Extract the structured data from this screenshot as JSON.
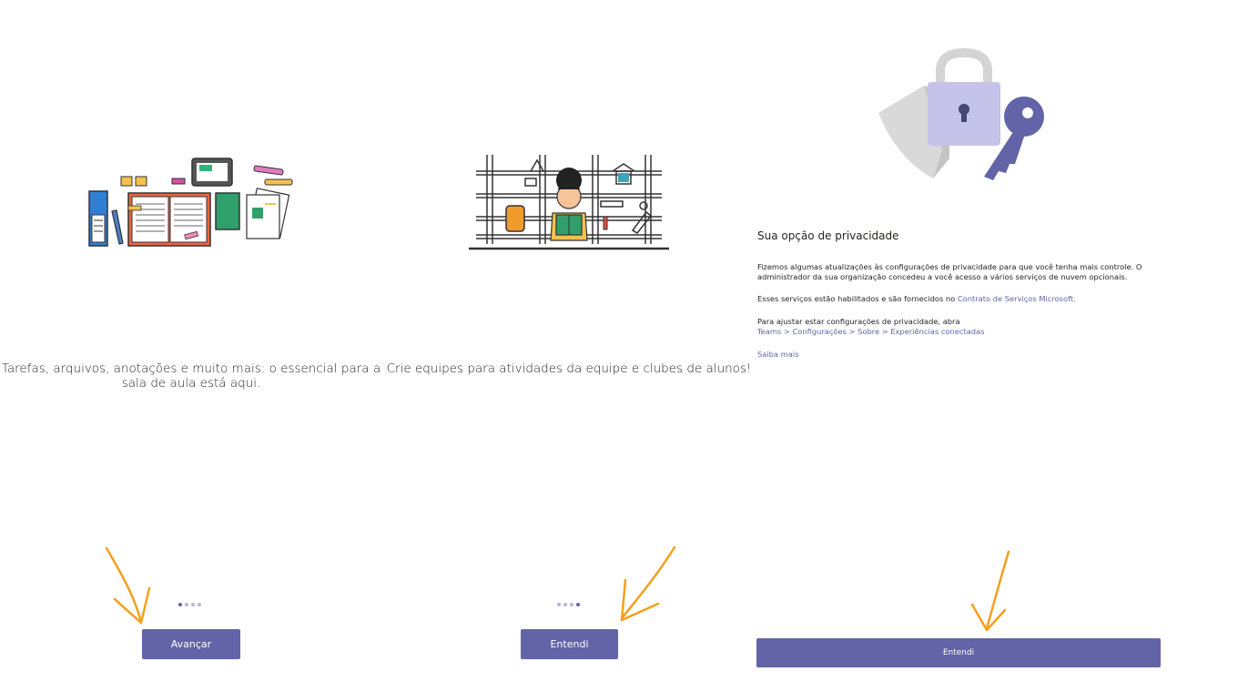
{
  "panels": [
    {
      "caption": "Tarefas, arquivos, anotações e muito mais: o essencial para a sala de aula está aqui.",
      "pager": {
        "total": 4,
        "active": 1
      },
      "button_label": "Avançar"
    },
    {
      "caption": "Crie equipes para atividades da equipe e clubes de alunos!",
      "pager": {
        "total": 4,
        "active": 4
      },
      "button_label": "Entendi"
    }
  ],
  "privacy": {
    "title": "Sua opção de privacidade",
    "paragraph1": "Fizemos algumas atualizações às configurações de privacidade para que você tenha mais controle. O administrador da sua organização concedeu a você acesso a vários serviços de nuvem opcionais.",
    "paragraph2_text": "Esses serviços estão habilitados e são fornecidos no ",
    "paragraph2_link": "Contrato de Serviços Microsoft.",
    "paragraph3_text": "Para ajustar estar configurações de privacidade, abra",
    "paragraph3_link": "Teams > Configurações > Sobre > Experiências conectadas",
    "learn_more": "Saiba mais",
    "button_label": "Entendi"
  },
  "colors": {
    "accent": "#6264a7",
    "arrow": "#f3a01c"
  }
}
